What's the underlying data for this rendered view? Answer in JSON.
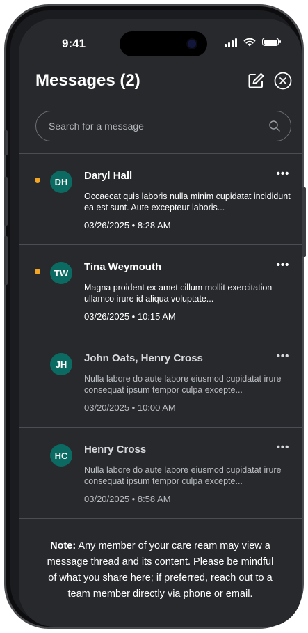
{
  "status_bar": {
    "time": "9:41"
  },
  "header": {
    "title": "Messages (2)"
  },
  "search": {
    "placeholder": "Search for a message",
    "value": ""
  },
  "colors": {
    "unread_dot": "#f3a623",
    "avatar_bg": "#0b6b62",
    "background": "#27292d"
  },
  "messages": [
    {
      "initials": "DH",
      "name": "Daryl Hall",
      "unread": true,
      "preview": "Occaecat quis laboris nulla minim cupidatat incididunt ea est sunt. Aute excepteur laboris...",
      "timestamp": "03/26/2025 • 8:28 AM",
      "more": "•••"
    },
    {
      "initials": "TW",
      "name": "Tina Weymouth",
      "unread": true,
      "preview": "Magna proident ex amet cillum mollit exercitation ullamco irure id aliqua voluptate...",
      "timestamp": "03/26/2025 • 10:15 AM",
      "more": "•••"
    },
    {
      "initials": "JH",
      "name": "John Oats, Henry Cross",
      "unread": false,
      "preview": "Nulla labore do aute labore eiusmod cupidatat irure consequat ipsum tempor culpa excepte...",
      "timestamp": "03/20/2025 • 10:00 AM",
      "more": "•••"
    },
    {
      "initials": "HC",
      "name": "Henry Cross",
      "unread": false,
      "preview": "Nulla labore do aute labore eiusmod cupidatat irure consequat ipsum tempor culpa excepte...",
      "timestamp": "03/20/2025 • 8:58 AM",
      "more": "•••"
    }
  ],
  "note": {
    "label": "Note:",
    "text": " Any member of your care ream may view a message thread and its content. Please be mindful of what you share here; if preferred, reach out to a team member directly via phone or email."
  }
}
